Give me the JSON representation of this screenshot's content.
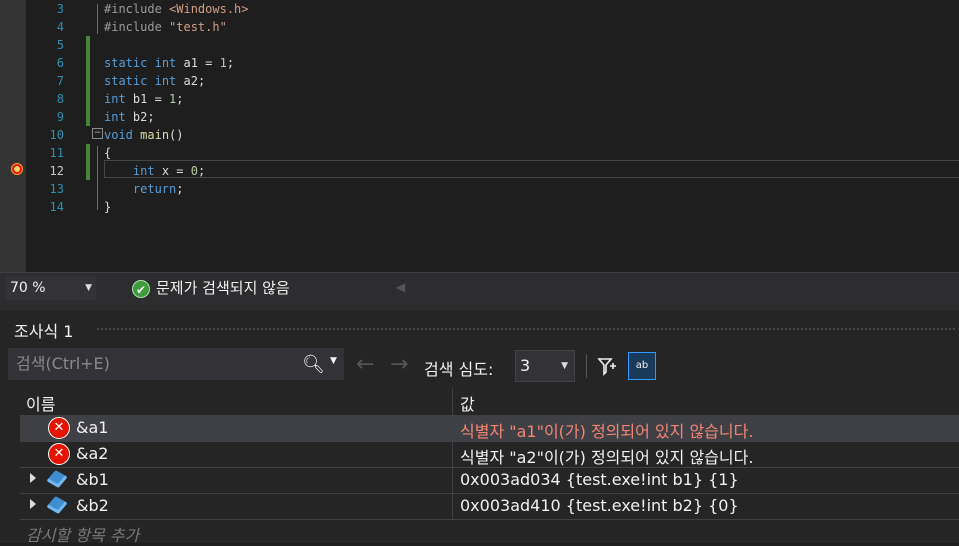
{
  "editor": {
    "lines": [
      {
        "num": "3",
        "html": "<span class=\"pp\">#include </span><span class=\"str\">&lt;Windows.h&gt;</span>"
      },
      {
        "num": "4",
        "html": "<span class=\"pp\">#include </span><span class=\"str\">\"test.h\"</span>"
      },
      {
        "num": "5",
        "html": ""
      },
      {
        "num": "6",
        "html": "<span class=\"kw\">static</span> <span class=\"kw\">int</span> a1 = <span class=\"num\">1</span>;"
      },
      {
        "num": "7",
        "html": "<span class=\"kw\">static</span> <span class=\"kw\">int</span> a2;"
      },
      {
        "num": "8",
        "html": "<span class=\"kw\">int</span> b1 = <span class=\"num\">1</span>;"
      },
      {
        "num": "9",
        "html": "<span class=\"kw\">int</span> b2;"
      },
      {
        "num": "10",
        "html": "<span class=\"kw\">void</span> <span class=\"fn\">main</span>()"
      },
      {
        "num": "11",
        "html": "{"
      },
      {
        "num": "12",
        "html": "    <span class=\"kw\">int</span> x = <span class=\"num\">0</span>;"
      },
      {
        "num": "13",
        "html": "    <span class=\"kw\">return</span>;"
      },
      {
        "num": "14",
        "html": "}"
      }
    ]
  },
  "statusbar": {
    "zoom": "70 %",
    "issues": "문제가 검색되지 않음"
  },
  "watch": {
    "title": "조사식 1",
    "search_placeholder": "검색(Ctrl+E)",
    "depth_label": "검색 심도:",
    "depth_value": "3",
    "col_name": "이름",
    "col_value": "값",
    "rows": [
      {
        "name": "&a1",
        "value": "식별자 \"a1\"이(가) 정의되어 있지 않습니다."
      },
      {
        "name": "&a2",
        "value": "식별자 \"a2\"이(가) 정의되어 있지 않습니다."
      },
      {
        "name": "&b1",
        "value": "0x003ad034 {test.exe!int b1} {1}"
      },
      {
        "name": "&b2",
        "value": "0x003ad410 {test.exe!int b2} {0}"
      }
    ],
    "add_item": "감시할 항목 추가"
  }
}
